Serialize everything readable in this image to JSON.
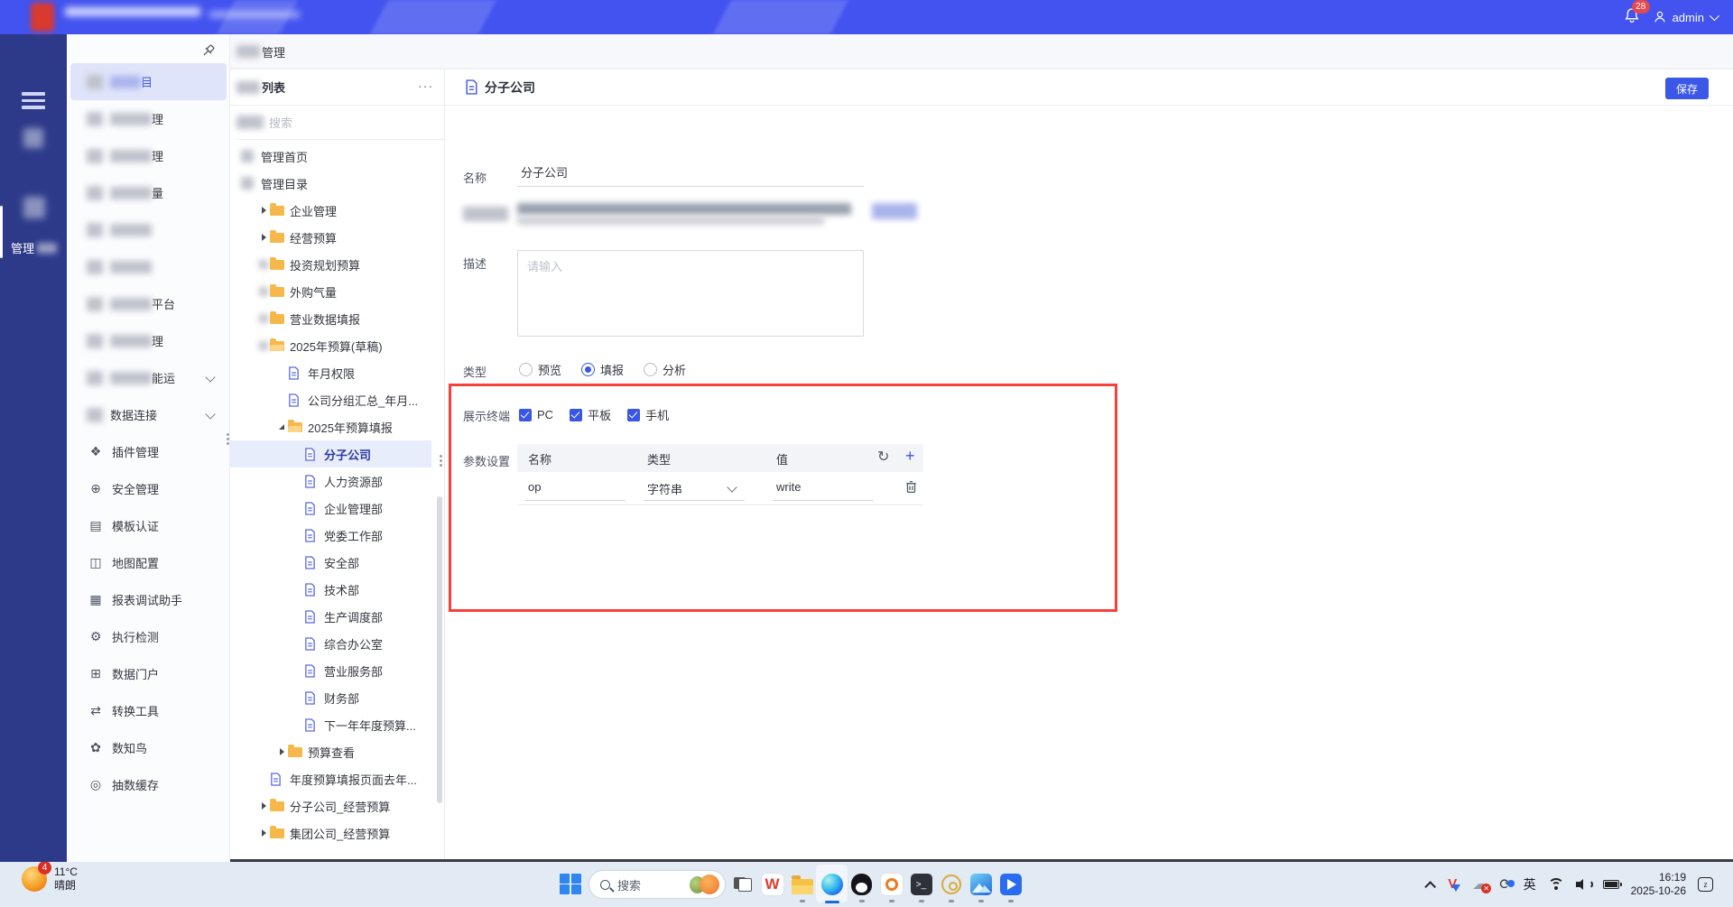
{
  "header": {
    "notification_count": "28",
    "username": "admin"
  },
  "sidebar_primary": {
    "active_label_fragment": "管理"
  },
  "sidebar_secondary": {
    "items": [
      {
        "blur": true,
        "fragment": "目",
        "selected": true
      },
      {
        "blur": true,
        "fragment": "理"
      },
      {
        "blur": true,
        "fragment": "理"
      },
      {
        "blur": true,
        "fragment": "量"
      },
      {
        "blur": true,
        "fragment": ""
      },
      {
        "blur": true,
        "fragment": ""
      },
      {
        "blur": true,
        "fragment": "平台"
      },
      {
        "blur": true,
        "fragment": "理"
      },
      {
        "blur": true,
        "fragment": "能运",
        "chevron": true
      },
      {
        "blur": true,
        "fragment": "数据连接",
        "chevron": true
      },
      {
        "label": "插件管理",
        "icon": "plugin-icon",
        "glyph": "❖"
      },
      {
        "label": "安全管理",
        "icon": "security-icon",
        "glyph": "⊕"
      },
      {
        "label": "模板认证",
        "icon": "template-cert-icon",
        "glyph": "▤"
      },
      {
        "label": "地图配置",
        "icon": "map-config-icon",
        "glyph": "◫"
      },
      {
        "label": "报表调试助手",
        "icon": "report-debug-icon",
        "glyph": "▦"
      },
      {
        "label": "执行检测",
        "icon": "exec-check-icon",
        "glyph": "⚙"
      },
      {
        "label": "数据门户",
        "icon": "data-portal-icon",
        "glyph": "⊞"
      },
      {
        "label": "转换工具",
        "icon": "convert-tool-icon",
        "glyph": "⇄"
      },
      {
        "label": "数知鸟",
        "icon": "shuzhiniao-icon",
        "glyph": "✿"
      },
      {
        "label": "抽数缓存",
        "icon": "data-cache-icon",
        "glyph": "◎"
      }
    ]
  },
  "content_header": {
    "title_fragment": "管理"
  },
  "tree_panel": {
    "header_fragment": "列表",
    "more_label": "···",
    "search_placeholder": "搜索",
    "nodes": [
      {
        "label": "管理首页",
        "depth": 0,
        "icon": "blur",
        "pre": "none"
      },
      {
        "label": "管理目录",
        "depth": 0,
        "icon": "blur",
        "pre": "none"
      },
      {
        "label": "企业管理",
        "depth": 1,
        "icon": "folder",
        "pre": "collapsed"
      },
      {
        "label": "经营预算",
        "depth": 1,
        "icon": "folder",
        "pre": "collapsed"
      },
      {
        "label": "投资规划预算",
        "depth": 1,
        "icon": "folder",
        "pre": "blur"
      },
      {
        "label": "外购气量",
        "depth": 1,
        "icon": "folder",
        "pre": "blur"
      },
      {
        "label": "营业数据填报",
        "depth": 1,
        "icon": "folder",
        "pre": "blur"
      },
      {
        "label": "2025年预算(草稿)",
        "depth": 1,
        "icon": "folder-open",
        "pre": "blur"
      },
      {
        "label": "年月权限",
        "depth": 2,
        "icon": "doc",
        "pre": "none"
      },
      {
        "label": "公司分组汇总_年月...",
        "depth": 2,
        "icon": "doc",
        "pre": "none"
      },
      {
        "label": "2025年预算填报",
        "depth": 2,
        "icon": "folder-open",
        "pre": "expanded"
      },
      {
        "label": "分子公司",
        "depth": 3,
        "icon": "doc",
        "pre": "none",
        "selected": true
      },
      {
        "label": "人力资源部",
        "depth": 3,
        "icon": "doc",
        "pre": "none"
      },
      {
        "label": "企业管理部",
        "depth": 3,
        "icon": "doc",
        "pre": "none"
      },
      {
        "label": "党委工作部",
        "depth": 3,
        "icon": "doc",
        "pre": "none"
      },
      {
        "label": "安全部",
        "depth": 3,
        "icon": "doc",
        "pre": "none"
      },
      {
        "label": "技术部",
        "depth": 3,
        "icon": "doc",
        "pre": "none"
      },
      {
        "label": "生产调度部",
        "depth": 3,
        "icon": "doc",
        "pre": "none"
      },
      {
        "label": "综合办公室",
        "depth": 3,
        "icon": "doc",
        "pre": "none"
      },
      {
        "label": "营业服务部",
        "depth": 3,
        "icon": "doc",
        "pre": "none"
      },
      {
        "label": "财务部",
        "depth": 3,
        "icon": "doc",
        "pre": "none"
      },
      {
        "label": "下一年年度预算...",
        "depth": 3,
        "icon": "doc",
        "pre": "none"
      },
      {
        "label": "预算查看",
        "depth": 2,
        "icon": "folder",
        "pre": "collapsed"
      },
      {
        "label": "年度预算填报页面去年...",
        "depth": 1,
        "icon": "doc",
        "pre": "none"
      },
      {
        "label": "分子公司_经营预算",
        "depth": 1,
        "icon": "folder",
        "pre": "collapsed"
      },
      {
        "label": "集团公司_经营预算",
        "depth": 1,
        "icon": "folder",
        "pre": "collapsed"
      }
    ]
  },
  "main": {
    "title": "分子公司",
    "save_label": "保存",
    "fields": {
      "name_label": "名称",
      "name_value": "分子公司",
      "desc_label": "描述",
      "desc_placeholder": "请输入",
      "type_label": "类型",
      "type_options": [
        {
          "label": "预览",
          "checked": false
        },
        {
          "label": "填报",
          "checked": true
        },
        {
          "label": "分析",
          "checked": false
        }
      ],
      "terminal_label": "展示终端",
      "terminal_options": [
        {
          "label": "PC",
          "checked": true
        },
        {
          "label": "平板",
          "checked": true
        },
        {
          "label": "手机",
          "checked": true
        }
      ],
      "params_label": "参数设置",
      "params_table": {
        "columns": [
          "名称",
          "类型",
          "值"
        ],
        "rows": [
          {
            "name": "op",
            "type": "字符串",
            "value": "write"
          }
        ]
      }
    }
  },
  "taskbar": {
    "weather_badge": "4",
    "temperature": "11°C",
    "condition": "晴朗",
    "search_placeholder": "搜索",
    "ime_label": "英",
    "time": "16:19",
    "date": "2025-10-26"
  }
}
